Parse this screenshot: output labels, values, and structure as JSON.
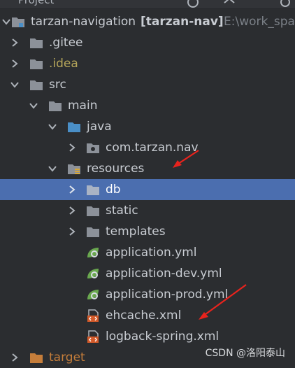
{
  "panel": {
    "title": "Project"
  },
  "project": {
    "name": "tarzan-navigation",
    "module": "[tarzan-nav]",
    "path": "E:\\work_spa"
  },
  "tree": [
    {
      "label": ".gitee",
      "icon": "folder-icon"
    },
    {
      "label": ".idea",
      "icon": "folder-icon"
    },
    {
      "label": "src",
      "icon": "folder-icon"
    },
    {
      "label": "main",
      "icon": "folder-icon"
    },
    {
      "label": "java",
      "icon": "source-folder-icon"
    },
    {
      "label": "com.tarzan.nav",
      "icon": "package-icon"
    },
    {
      "label": "resources",
      "icon": "resources-folder-icon"
    },
    {
      "label": "db",
      "icon": "folder-icon",
      "selected": true
    },
    {
      "label": "static",
      "icon": "folder-icon"
    },
    {
      "label": "templates",
      "icon": "folder-icon"
    },
    {
      "label": "application.yml",
      "icon": "spring-config-icon"
    },
    {
      "label": "application-dev.yml",
      "icon": "spring-config-icon"
    },
    {
      "label": "application-prod.yml",
      "icon": "spring-config-icon"
    },
    {
      "label": "ehcache.xml",
      "icon": "xml-file-icon"
    },
    {
      "label": "logback-spring.xml",
      "icon": "xml-file-icon"
    },
    {
      "label": "target",
      "icon": "excluded-folder-icon"
    }
  ],
  "watermark": "CSDN @洛阳泰山",
  "colors": {
    "background": "#2b2d30",
    "selection": "#4b6eaf",
    "folder": "#8c9199",
    "source_folder": "#4a8fc7",
    "excluded_folder": "#c57d3a",
    "annotation_arrow": "#e8231d"
  }
}
